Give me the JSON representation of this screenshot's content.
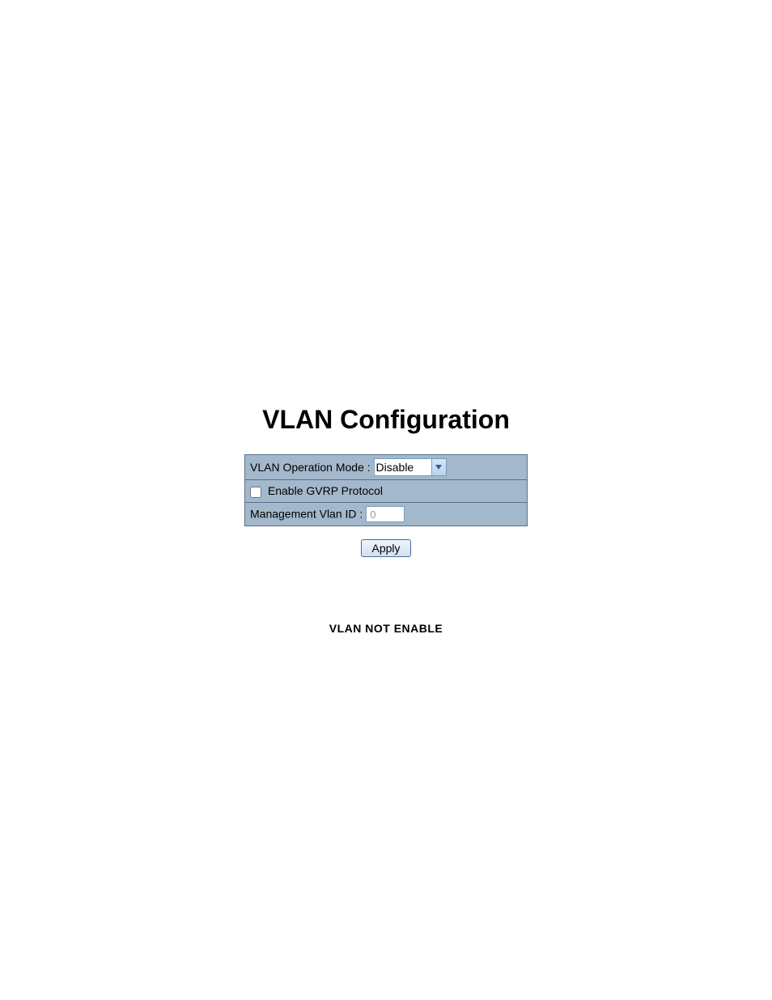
{
  "title": "VLAN Configuration",
  "rows": {
    "operation_mode": {
      "label": "VLAN Operation Mode : ",
      "selected": "Disable"
    },
    "gvrp": {
      "label": "Enable GVRP Protocol"
    },
    "management_vlan": {
      "label": "Management Vlan ID : ",
      "value": "0"
    }
  },
  "apply_label": "Apply",
  "status": "VLAN NOT ENABLE"
}
